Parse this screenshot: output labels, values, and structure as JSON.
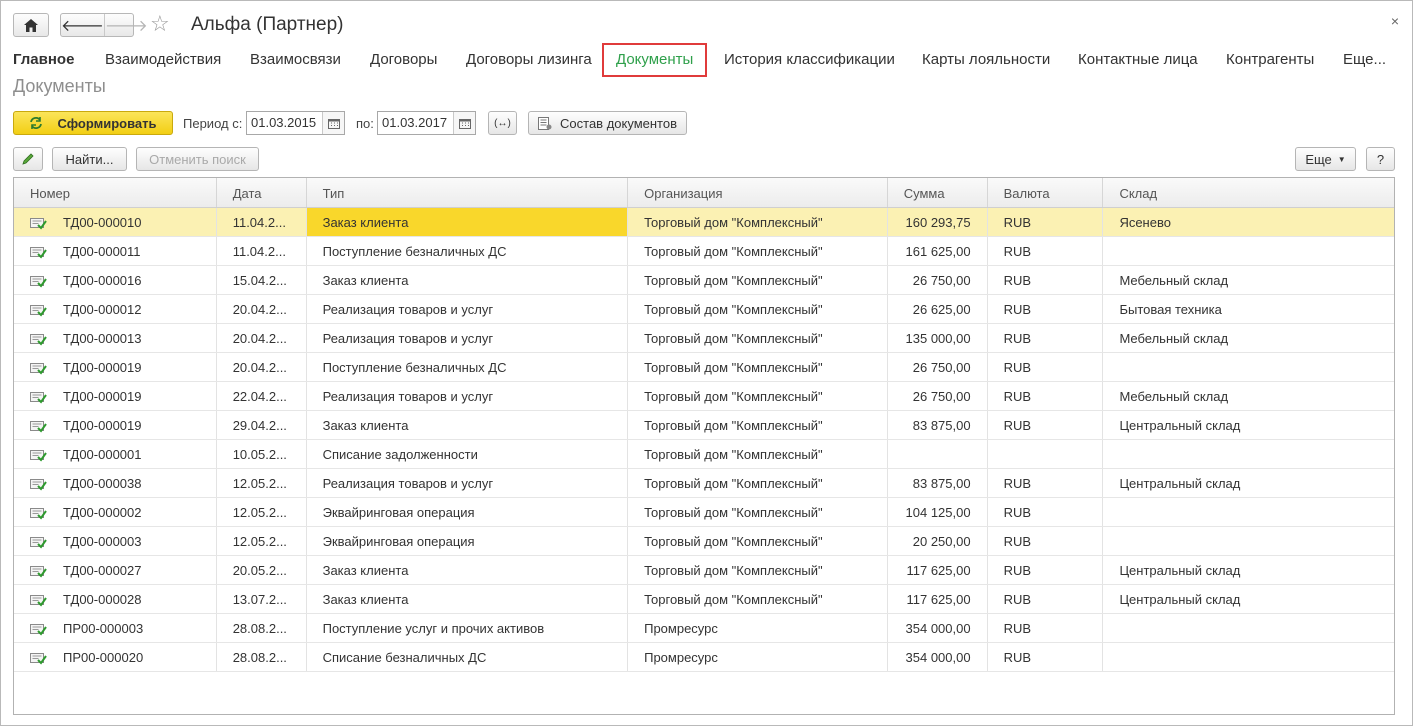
{
  "window": {
    "title": "Альфа (Партнер)",
    "close_label": "×"
  },
  "sections": [
    {
      "label": "Главное"
    },
    {
      "label": "Взаимодействия"
    },
    {
      "label": "Взаимосвязи"
    },
    {
      "label": "Договоры"
    },
    {
      "label": "Договоры лизинга"
    },
    {
      "label": "Документы"
    },
    {
      "label": "История классификации"
    },
    {
      "label": "Карты лояльности"
    },
    {
      "label": "Контактные лица"
    },
    {
      "label": "Контрагенты"
    },
    {
      "label": "Еще..."
    }
  ],
  "page": {
    "heading": "Документы"
  },
  "toolbar": {
    "generate_label": "Сформировать",
    "period_from_label": "Период с:",
    "period_from_value": "01.03.2015",
    "period_to_label": "по:",
    "period_to_value": "01.03.2017",
    "period_select_label": "(↔)",
    "doc_composition_label": "Состав документов",
    "find_label": "Найти...",
    "cancel_search_label": "Отменить поиск",
    "more_label": "Еще",
    "help_label": "?"
  },
  "table": {
    "columns": [
      "Номер",
      "Дата",
      "Тип",
      "Организация",
      "Сумма",
      "Валюта",
      "Склад"
    ],
    "rows": [
      {
        "num": "ТД00-000010",
        "date": "11.04.2...",
        "type": "Заказ клиента",
        "org": "Торговый дом \"Комплексный\"",
        "sum": "160 293,75",
        "cur": "RUB",
        "store": "Ясенево"
      },
      {
        "num": "ТД00-000011",
        "date": "11.04.2...",
        "type": "Поступление безналичных ДС",
        "org": "Торговый дом \"Комплексный\"",
        "sum": "161 625,00",
        "cur": "RUB",
        "store": ""
      },
      {
        "num": "ТД00-000016",
        "date": "15.04.2...",
        "type": "Заказ клиента",
        "org": "Торговый дом \"Комплексный\"",
        "sum": "26 750,00",
        "cur": "RUB",
        "store": "Мебельный склад"
      },
      {
        "num": "ТД00-000012",
        "date": "20.04.2...",
        "type": "Реализация товаров и услуг",
        "org": "Торговый дом \"Комплексный\"",
        "sum": "26 625,00",
        "cur": "RUB",
        "store": "Бытовая техника"
      },
      {
        "num": "ТД00-000013",
        "date": "20.04.2...",
        "type": "Реализация товаров и услуг",
        "org": "Торговый дом \"Комплексный\"",
        "sum": "135 000,00",
        "cur": "RUB",
        "store": "Мебельный склад"
      },
      {
        "num": "ТД00-000019",
        "date": "20.04.2...",
        "type": "Поступление безналичных ДС",
        "org": "Торговый дом \"Комплексный\"",
        "sum": "26 750,00",
        "cur": "RUB",
        "store": ""
      },
      {
        "num": "ТД00-000019",
        "date": "22.04.2...",
        "type": "Реализация товаров и услуг",
        "org": "Торговый дом \"Комплексный\"",
        "sum": "26 750,00",
        "cur": "RUB",
        "store": "Мебельный склад"
      },
      {
        "num": "ТД00-000019",
        "date": "29.04.2...",
        "type": "Заказ клиента",
        "org": "Торговый дом \"Комплексный\"",
        "sum": "83 875,00",
        "cur": "RUB",
        "store": "Центральный склад"
      },
      {
        "num": "ТД00-000001",
        "date": "10.05.2...",
        "type": "Списание задолженности",
        "org": "Торговый дом \"Комплексный\"",
        "sum": "",
        "cur": "",
        "store": ""
      },
      {
        "num": "ТД00-000038",
        "date": "12.05.2...",
        "type": "Реализация товаров и услуг",
        "org": "Торговый дом \"Комплексный\"",
        "sum": "83 875,00",
        "cur": "RUB",
        "store": "Центральный склад"
      },
      {
        "num": "ТД00-000002",
        "date": "12.05.2...",
        "type": "Эквайринговая операция",
        "org": "Торговый дом \"Комплексный\"",
        "sum": "104 125,00",
        "cur": "RUB",
        "store": ""
      },
      {
        "num": "ТД00-000003",
        "date": "12.05.2...",
        "type": "Эквайринговая операция",
        "org": "Торговый дом \"Комплексный\"",
        "sum": "20 250,00",
        "cur": "RUB",
        "store": ""
      },
      {
        "num": "ТД00-000027",
        "date": "20.05.2...",
        "type": "Заказ клиента",
        "org": "Торговый дом \"Комплексный\"",
        "sum": "117 625,00",
        "cur": "RUB",
        "store": "Центральный склад"
      },
      {
        "num": "ТД00-000028",
        "date": "13.07.2...",
        "type": "Заказ клиента",
        "org": "Торговый дом \"Комплексный\"",
        "sum": "117 625,00",
        "cur": "RUB",
        "store": "Центральный склад"
      },
      {
        "num": "ПР00-000003",
        "date": "28.08.2...",
        "type": "Поступление услуг и прочих активов",
        "org": "Промресурс",
        "sum": "354 000,00",
        "cur": "RUB",
        "store": ""
      },
      {
        "num": "ПР00-000020",
        "date": "28.08.2...",
        "type": "Списание безналичных ДС",
        "org": "Промресурс",
        "sum": "354 000,00",
        "cur": "RUB",
        "store": ""
      }
    ]
  },
  "icons": {
    "home": "home-icon",
    "back": "arrow-left-icon",
    "forward": "arrow-right-icon",
    "favorite": "star-icon",
    "close": "close-icon",
    "refresh": "refresh-icon",
    "calendar": "calendar-icon",
    "edit": "pencil-icon",
    "doc": "posted-document-icon"
  },
  "colors": {
    "accent_yellow": "#f2cf14",
    "active_section": "#2fa04b",
    "active_border": "#e03b3b",
    "selected_row": "#fbf1b3"
  }
}
